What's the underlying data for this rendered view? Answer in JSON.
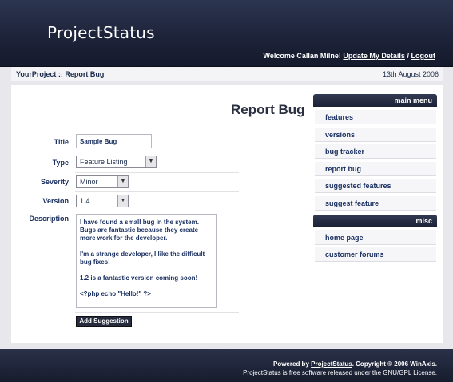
{
  "header": {
    "logo": "ProjectStatus",
    "welcome_prefix": "Welcome Callan Milne!",
    "update_link": "Update My Details",
    "separator": "/",
    "logout_link": "Logout"
  },
  "breadcrumb": {
    "text": "YourProject :: Report Bug",
    "date": "13th August 2006"
  },
  "form": {
    "page_title": "Report Bug",
    "title_label": "Title",
    "title_value": "Sample Bug",
    "type_label": "Type",
    "type_value": "Feature Listing",
    "severity_label": "Severity",
    "severity_value": "Minor",
    "version_label": "Version",
    "version_value": "1.4",
    "description_label": "Description",
    "description_value": "I have found a small bug in the system.\nBugs are fantastic because they create more work for the developer.\n\nI'm a strange developer, I like the difficult bug fixes!\n\n1.2 is a fantastic version coming soon!\n\n<?php echo \"Hello!\" ?>",
    "submit_label": "Add Suggestion"
  },
  "main_menu": {
    "heading": "main menu",
    "items": [
      "features",
      "versions",
      "bug tracker",
      "report bug",
      "suggested features",
      "suggest feature"
    ]
  },
  "misc_menu": {
    "heading": "misc",
    "items": [
      "home page",
      "customer forums"
    ]
  },
  "footer": {
    "powered_prefix": "Powered by",
    "powered_link": "ProjectStatus",
    "copyright": ". Copyright © 2006 WinAxis.",
    "license": "ProjectStatus is free software released under the GNU/GPL License."
  }
}
